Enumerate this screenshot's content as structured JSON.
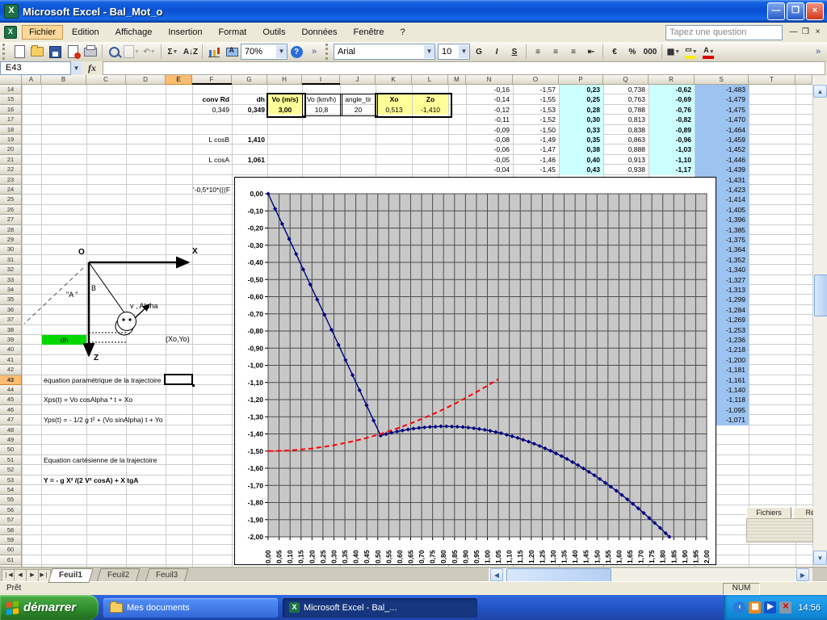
{
  "window": {
    "title": "Microsoft Excel - Bal_Mot_o"
  },
  "menubar": {
    "items": [
      "Fichier",
      "Edition",
      "Affichage",
      "Insertion",
      "Format",
      "Outils",
      "Données",
      "Fenêtre",
      "?"
    ],
    "selected_item": "Fichier",
    "question_placeholder": "Tapez une question"
  },
  "toolbar": {
    "zoom_value": "70%",
    "font_name": "Arial",
    "font_size": "10",
    "std_icons": [
      {
        "name": "new-document-icon",
        "type": "doc"
      },
      {
        "name": "open-icon",
        "type": "folder"
      },
      {
        "name": "save-icon",
        "type": "floppy"
      },
      {
        "name": "permission-icon",
        "type": "perm"
      },
      {
        "name": "print-icon",
        "type": "printer"
      },
      {
        "name": "search-icon",
        "type": "search"
      },
      {
        "name": "paste-icon",
        "type": "doc",
        "disabled": true,
        "dropdown": true
      },
      {
        "name": "undo-icon",
        "type": "text",
        "glyph": "↶",
        "disabled": true,
        "dropdown": true
      },
      {
        "name": "autosum-icon",
        "type": "text",
        "glyph": "Σ",
        "dropdown": true
      },
      {
        "name": "sort-ascending-icon",
        "type": "text",
        "glyph": "A↓Z"
      },
      {
        "name": "chart-wizard-icon",
        "type": "bars"
      },
      {
        "name": "drawing-icon",
        "type": "draw"
      }
    ],
    "fmt_icons": [
      {
        "name": "bold-button",
        "glyph": "G"
      },
      {
        "name": "italic-button",
        "glyph": "I",
        "italic": true
      },
      {
        "name": "underline-button",
        "glyph": "S",
        "underline": true
      },
      {
        "name": "align-left-button",
        "glyph": "≡"
      },
      {
        "name": "align-center-button",
        "glyph": "≡"
      },
      {
        "name": "align-right-button",
        "glyph": "≡"
      },
      {
        "name": "merge-center-button",
        "glyph": "⇤"
      },
      {
        "name": "currency-button",
        "glyph": "€"
      },
      {
        "name": "percent-button",
        "glyph": "%"
      },
      {
        "name": "thousands-button",
        "glyph": "000"
      },
      {
        "name": "borders-button",
        "glyph": "▦",
        "dropdown": true
      },
      {
        "name": "fill-color-button",
        "glyph": "▭",
        "bar": "#ffee00",
        "dropdown": true
      },
      {
        "name": "font-color-button",
        "glyph": "A",
        "bar": "#dd0000",
        "dropdown": true
      }
    ]
  },
  "formula_bar": {
    "cell_ref": "E43",
    "fx_label": "fx",
    "formula": ""
  },
  "sheet": {
    "columns": [
      "A",
      "B",
      "C",
      "D",
      "E",
      "F",
      "G",
      "H",
      "I",
      "J",
      "K",
      "L",
      "M",
      "N",
      "O",
      "P",
      "Q",
      "R",
      "S",
      "T"
    ],
    "first_row": 14,
    "last_row": 62,
    "active_column": "E",
    "active_row": 43,
    "cells": [
      {
        "c": "F",
        "r": 15,
        "t": "conv Rd",
        "al": "r",
        "b": 1
      },
      {
        "c": "G",
        "r": 15,
        "t": "dh",
        "al": "r",
        "b": 1
      },
      {
        "c": "H",
        "r": 15,
        "t": "Vo (m/s)",
        "al": "c",
        "b": 1,
        "bg": "#ffff99"
      },
      {
        "c": "I",
        "r": 15,
        "t": "Vo (km/h)",
        "al": "c"
      },
      {
        "c": "J",
        "r": 15,
        "t": "angle_tir",
        "al": "c"
      },
      {
        "c": "K",
        "r": 15,
        "t": "Xo",
        "al": "c",
        "b": 1,
        "bg": "#ffff99"
      },
      {
        "c": "L",
        "r": 15,
        "t": "Zo",
        "al": "c",
        "b": 1,
        "bg": "#ffff99"
      },
      {
        "c": "F",
        "r": 16,
        "t": "0,349",
        "al": "r"
      },
      {
        "c": "G",
        "r": 16,
        "t": "0,349",
        "al": "r",
        "b": 1
      },
      {
        "c": "H",
        "r": 16,
        "t": "3,00",
        "al": "c",
        "b": 1,
        "bg": "#ffff99"
      },
      {
        "c": "I",
        "r": 16,
        "t": "10,8",
        "al": "c"
      },
      {
        "c": "J",
        "r": 16,
        "t": "20",
        "al": "c"
      },
      {
        "c": "K",
        "r": 16,
        "t": "0,513",
        "al": "c",
        "bg": "#ffff99"
      },
      {
        "c": "L",
        "r": 16,
        "t": "-1,410",
        "al": "c",
        "bg": "#ffff99"
      },
      {
        "c": "F",
        "r": 19,
        "t": "L cosB",
        "al": "r"
      },
      {
        "c": "G",
        "r": 19,
        "t": "1,410",
        "al": "r",
        "b": 1
      },
      {
        "c": "F",
        "r": 21,
        "t": "L cosA",
        "al": "r"
      },
      {
        "c": "G",
        "r": 21,
        "t": "1,061",
        "al": "r",
        "b": 1
      },
      {
        "c": "F",
        "r": 24,
        "t": "'-0,5*10*(((F",
        "al": "r"
      },
      {
        "c": "B",
        "r": 39,
        "t": "dh",
        "al": "c",
        "bg": "#00d800"
      },
      {
        "c": "B",
        "r": 43,
        "t": "équation paramétrique de la trajectoire",
        "al": "l",
        "spill": 1
      },
      {
        "c": "B",
        "r": 45,
        "t": "Xps(t) = Vo cosAlpha * t + Xo",
        "al": "l",
        "spill": 1
      },
      {
        "c": "B",
        "r": 47,
        "t": "Yps(t) = - 1/2 g t² + (Vo sinAlpha) t + Yo",
        "al": "l",
        "spill": 1
      },
      {
        "c": "B",
        "r": 51,
        "t": "Equation cartésienne de la trajectoire",
        "al": "l",
        "spill": 1
      },
      {
        "c": "B",
        "r": 53,
        "t": "Y = - g X² /(2 V² cosA)  + X tgA",
        "al": "l",
        "b": 1,
        "spill": 1
      }
    ],
    "data_columns": [
      {
        "col": "N",
        "start_row": 14,
        "values": [
          "-0,16",
          "-0,14",
          "-0,12",
          "-0,11",
          "-0,09",
          "-0,08",
          "-0,06",
          "-0,05",
          "-0,04"
        ]
      },
      {
        "col": "O",
        "start_row": 14,
        "values": [
          "-1,57",
          "-1,55",
          "-1,53",
          "-1,52",
          "-1,50",
          "-1,49",
          "-1,47",
          "-1,46",
          "-1,45"
        ]
      },
      {
        "col": "P",
        "start_row": 14,
        "bold": true,
        "fill": "#ccffff",
        "values": [
          "0,23",
          "0,25",
          "0,28",
          "0,30",
          "0,33",
          "0,35",
          "0,38",
          "0,40",
          "0,43"
        ]
      },
      {
        "col": "Q",
        "start_row": 14,
        "values": [
          "0,738",
          "0,763",
          "0,788",
          "0,813",
          "0,838",
          "0,863",
          "0,888",
          "0,913",
          "0,938"
        ]
      },
      {
        "col": "R",
        "start_row": 14,
        "bold": true,
        "fill": "#ccffff",
        "values": [
          "-0,62",
          "-0,69",
          "-0,76",
          "-0,82",
          "-0,89",
          "-0,96",
          "-1,03",
          "-1,10",
          "-1,17"
        ]
      },
      {
        "col": "S",
        "start_row": 14,
        "fill": "#9dc3f0",
        "values": [
          "-1,483",
          "-1,479",
          "-1,475",
          "-1,470",
          "-1,464",
          "-1,459",
          "-1,452",
          "-1,446",
          "-1,439",
          "-1,431",
          "-1,423",
          "-1,414",
          "-1,405",
          "-1,396",
          "-1,385",
          "-1,375",
          "-1,364",
          "-1,352",
          "-1,340",
          "-1,327",
          "-1,313",
          "-1,299",
          "-1,284",
          "-1,269",
          "-1,253",
          "-1,236",
          "-1,218",
          "-1,200",
          "-1,181",
          "-1,161",
          "-1,140",
          "-1,118",
          "-1,095",
          "-1,071"
        ]
      }
    ],
    "diagram": {
      "origin_label": "O",
      "x_axis_label": "X",
      "z_axis_label": "Z",
      "b_label": "B",
      "a_label": "\"A  \"",
      "velocity_label": "v , Alpha",
      "point_label": "(Xo,Yo)",
      "dh_label": "dh"
    },
    "widgets": {
      "fichiers_label": "Fichiers",
      "reseau_label": "Réseau"
    }
  },
  "chart_data": {
    "type": "line",
    "title": "",
    "x_axis": {
      "min": 0,
      "max": 2,
      "tick_step": 0.05,
      "labels_rotated": true
    },
    "y_axis": {
      "min": -2,
      "max": 0,
      "tick_step": 0.1
    },
    "decimal_separator": ",",
    "grid": true,
    "legend": false,
    "plot_background": "#c8c8c8",
    "series": [
      {
        "id": "trajectory-blue",
        "color": "#000080",
        "line_style": "solid",
        "marker": "diamond",
        "points": [
          [
            0,
            0
          ],
          [
            0.032,
            -0.088
          ],
          [
            0.064,
            -0.176
          ],
          [
            0.096,
            -0.264
          ],
          [
            0.128,
            -0.352
          ],
          [
            0.16,
            -0.441
          ],
          [
            0.192,
            -0.529
          ],
          [
            0.224,
            -0.617
          ],
          [
            0.257,
            -0.705
          ],
          [
            0.289,
            -0.793
          ],
          [
            0.321,
            -0.881
          ],
          [
            0.353,
            -0.969
          ],
          [
            0.385,
            -1.057
          ],
          [
            0.417,
            -1.145
          ],
          [
            0.449,
            -1.233
          ],
          [
            0.481,
            -1.322
          ],
          [
            0.513,
            -1.41
          ],
          [
            0.538,
            -1.401
          ],
          [
            0.563,
            -1.393
          ],
          [
            0.588,
            -1.386
          ],
          [
            0.613,
            -1.38
          ],
          [
            0.638,
            -1.374
          ],
          [
            0.663,
            -1.369
          ],
          [
            0.688,
            -1.365
          ],
          [
            0.713,
            -1.362
          ],
          [
            0.738,
            -1.359
          ],
          [
            0.763,
            -1.358
          ],
          [
            0.788,
            -1.356
          ],
          [
            0.813,
            -1.356
          ],
          [
            0.838,
            -1.357
          ],
          [
            0.863,
            -1.358
          ],
          [
            0.888,
            -1.36
          ],
          [
            0.913,
            -1.363
          ],
          [
            0.938,
            -1.367
          ],
          [
            0.963,
            -1.371
          ],
          [
            0.988,
            -1.376
          ],
          [
            1.013,
            -1.382
          ],
          [
            1.038,
            -1.389
          ],
          [
            1.063,
            -1.396
          ],
          [
            1.088,
            -1.405
          ],
          [
            1.113,
            -1.414
          ],
          [
            1.138,
            -1.423
          ],
          [
            1.163,
            -1.434
          ],
          [
            1.188,
            -1.445
          ],
          [
            1.213,
            -1.457
          ],
          [
            1.238,
            -1.47
          ],
          [
            1.263,
            -1.484
          ],
          [
            1.288,
            -1.498
          ],
          [
            1.313,
            -1.514
          ],
          [
            1.338,
            -1.529
          ],
          [
            1.363,
            -1.546
          ],
          [
            1.388,
            -1.564
          ],
          [
            1.413,
            -1.582
          ],
          [
            1.438,
            -1.601
          ],
          [
            1.463,
            -1.621
          ],
          [
            1.488,
            -1.641
          ],
          [
            1.513,
            -1.663
          ],
          [
            1.538,
            -1.685
          ],
          [
            1.563,
            -1.708
          ],
          [
            1.588,
            -1.731
          ],
          [
            1.613,
            -1.756
          ],
          [
            1.638,
            -1.781
          ],
          [
            1.663,
            -1.807
          ],
          [
            1.688,
            -1.834
          ],
          [
            1.713,
            -1.861
          ],
          [
            1.738,
            -1.89
          ],
          [
            1.763,
            -1.919
          ],
          [
            1.788,
            -1.948
          ],
          [
            1.813,
            -1.979
          ],
          [
            1.83,
            -2.0
          ]
        ]
      },
      {
        "id": "reference-red",
        "color": "#ff0000",
        "line_style": "dashed",
        "marker": "none",
        "points": [
          [
            0,
            -1.5
          ],
          [
            0.05,
            -1.499
          ],
          [
            0.1,
            -1.496
          ],
          [
            0.15,
            -1.491
          ],
          [
            0.2,
            -1.485
          ],
          [
            0.25,
            -1.476
          ],
          [
            0.3,
            -1.466
          ],
          [
            0.35,
            -1.453
          ],
          [
            0.4,
            -1.439
          ],
          [
            0.45,
            -1.423
          ],
          [
            0.5,
            -1.405
          ],
          [
            0.55,
            -1.385
          ],
          [
            0.6,
            -1.363
          ],
          [
            0.65,
            -1.339
          ],
          [
            0.7,
            -1.313
          ],
          [
            0.75,
            -1.286
          ],
          [
            0.8,
            -1.256
          ],
          [
            0.85,
            -1.225
          ],
          [
            0.9,
            -1.191
          ],
          [
            0.95,
            -1.156
          ],
          [
            1.0,
            -1.119
          ],
          [
            1.05,
            -1.08
          ]
        ]
      }
    ]
  },
  "tabs": {
    "items": [
      "Feuil1",
      "Feuil2",
      "Feuil3"
    ],
    "active": "Feuil1"
  },
  "status_bar": {
    "mode": "Prêt",
    "num_lock": "NUM"
  },
  "taskbar": {
    "start_label": "démarrer",
    "tasks": [
      {
        "label": "Mes documents",
        "icon": "folder-icon",
        "active": false
      },
      {
        "label": "Microsoft Excel - Bal_...",
        "icon": "excel-icon",
        "active": true
      }
    ],
    "clock": "14:56"
  }
}
